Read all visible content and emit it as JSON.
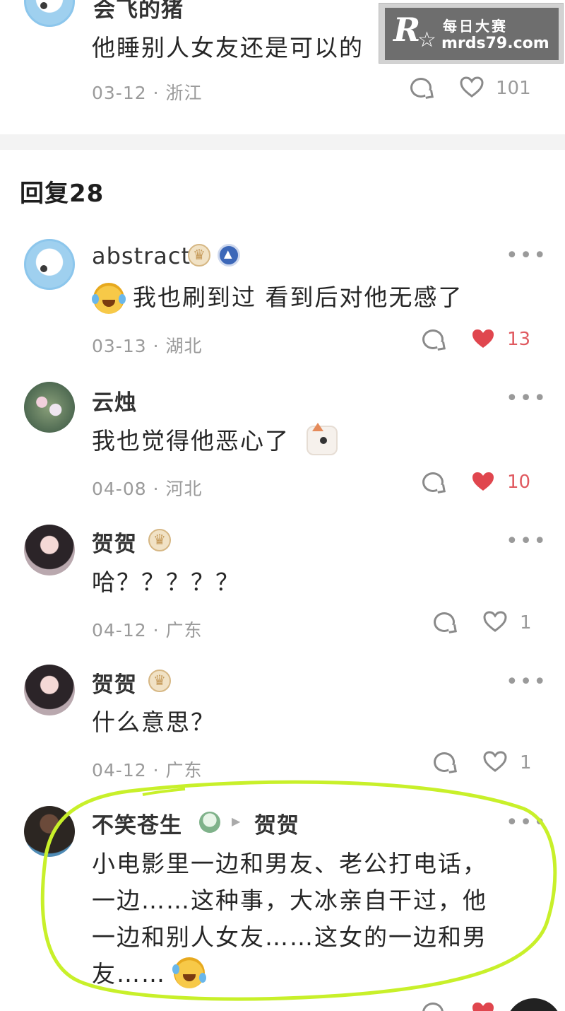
{
  "top_comment": {
    "username": "会飞的猪",
    "text": "他睡别人女友还是可以的",
    "date": "03-12",
    "location": "浙江",
    "likes": "101"
  },
  "watermark": {
    "logo": "R",
    "name": "每日大赛",
    "url": "mrds79.com"
  },
  "section_title": "回复28",
  "meta_separator": "·",
  "more_label": "•••",
  "replies": [
    {
      "username": "abstract",
      "text": "我也刷到过 看到后对他无感了",
      "emoji_name": "laughing-crying-emoji",
      "date": "03-13",
      "location": "湖北",
      "likes": "13",
      "liked": true
    },
    {
      "username": "云烛",
      "text": "我也觉得他恶心了",
      "emoji_name": "cat-emoji",
      "date": "04-08",
      "location": "河北",
      "likes": "10",
      "liked": true
    },
    {
      "username": "贺贺",
      "text": "哈？？？？？",
      "date": "04-12",
      "location": "广东",
      "likes": "1",
      "liked": false
    },
    {
      "username": "贺贺",
      "text": "什么意思？",
      "date": "04-12",
      "location": "广东",
      "likes": "1",
      "liked": false
    },
    {
      "username": "不笑苍生",
      "reply_to": "贺贺",
      "text_lines": [
        "小电影里一边和男友、老公打电话，",
        "一边……这种事，大冰亲自干过，他",
        "一边和别人女友……这女的一边和男",
        "友……"
      ],
      "emoji_name": "rofl-emoji"
    }
  ],
  "colors": {
    "like_red": "#e0464e",
    "highlight_green": "#c8f02a",
    "meta_gray": "#9a9a9a"
  }
}
